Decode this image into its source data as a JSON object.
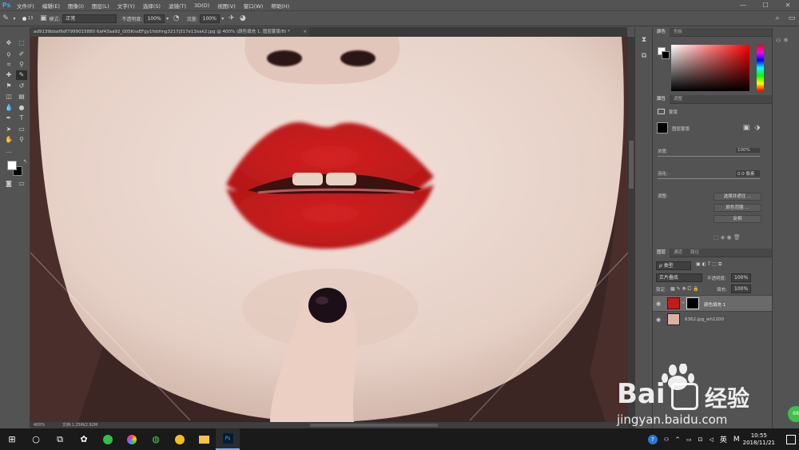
{
  "menubar": {
    "app_logo": "Ps",
    "items": [
      "文件(F)",
      "编辑(E)",
      "图像(I)",
      "图层(L)",
      "文字(Y)",
      "选择(S)",
      "滤镜(T)",
      "3D(D)",
      "视图(V)",
      "窗口(W)",
      "帮助(H)"
    ],
    "window_controls": [
      "—",
      "☐",
      "✕"
    ]
  },
  "options_bar": {
    "brush_size": "13",
    "mode_label": "模式:",
    "mode_value": "正常",
    "opacity_label": "不透明度:",
    "opacity_value": "100%",
    "flow_label": "流量:",
    "flow_value": "100%"
  },
  "document": {
    "tab_title": "ad9139bbaf9df7999015880 6af43aa92_005KnsEFgy1fsbfmg3217j317e13xak2.jpg @ 400% (颜色填充 1, 图层蒙版/8) *",
    "close": "×",
    "zoom": "400%",
    "doc_size": "文档:1.25M/2.92M"
  },
  "color_panel": {
    "tabs": [
      "颜色",
      "色板"
    ],
    "foreground": "#ffffff",
    "background": "#000000"
  },
  "properties_panel": {
    "tabs": [
      "属性",
      "调整"
    ],
    "section": "蒙版",
    "mask_label": "图层蒙版",
    "density_label": "浓度:",
    "density_value": "100%",
    "feather_label": "羽化:",
    "feather_value": "0.0 像素",
    "adjust_label": "调整:",
    "buttons": [
      "选择并遮住 ...",
      "颜色范围 ...",
      "反相"
    ]
  },
  "layers_panel": {
    "tabs": [
      "图层",
      "通道",
      "路径"
    ],
    "filter_label": "ρ 类型",
    "blend_mode": "正片叠底",
    "opacity_label": "不透明度:",
    "opacity_value": "100%",
    "lock_label": "锁定:",
    "fill_label": "填充:",
    "fill_value": "100%",
    "layers": [
      {
        "name": "颜色填充 1",
        "color": "#c41a1a"
      },
      {
        "name": "6362.jpg_wh1200",
        "color": "#d9b2a5"
      }
    ]
  },
  "watermark": {
    "brand_left": "Bai",
    "brand_right": "经验",
    "url": "jingyan.baidu.com"
  },
  "taskbar": {
    "ime": "英",
    "ime2": "M",
    "time": "10:55",
    "date": "2018/11/21",
    "badge": "68"
  },
  "colors": {
    "lip_red": "#c91c1c",
    "skin": "#ead7cf",
    "ps_blue": "#31a8ff"
  }
}
